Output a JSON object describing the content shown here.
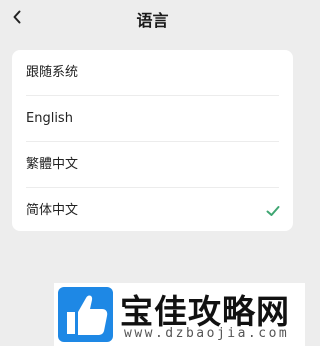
{
  "header": {
    "title": "语言",
    "back_icon": "chevron-left-icon"
  },
  "languages": [
    {
      "label": "跟随系统",
      "selected": false
    },
    {
      "label": "English",
      "selected": false
    },
    {
      "label": "繁體中文",
      "selected": false
    },
    {
      "label": "简体中文",
      "selected": true
    }
  ],
  "check_icon": "checkmark-icon",
  "colors": {
    "accent": "#3fa672",
    "background": "#ededed",
    "card": "#ffffff"
  },
  "watermark": {
    "name": "宝佳攻略网",
    "url": "www.dzbaojia.com",
    "logo_icon": "thumbs-up-icon"
  }
}
